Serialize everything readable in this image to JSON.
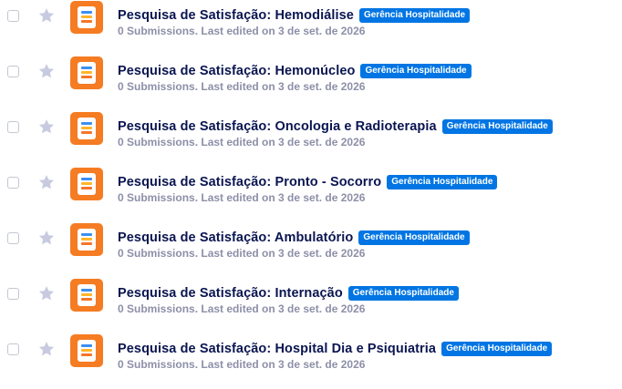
{
  "forms": [
    {
      "title": "Pesquisa de Satisfação: Hemodiálise",
      "badge": "Gerência Hospitalidade",
      "meta": "0 Submissions. Last edited on 3 de set. de 2026"
    },
    {
      "title": "Pesquisa de Satisfação: Hemonúcleo",
      "badge": "Gerência Hospitalidade",
      "meta": "0 Submissions. Last edited on 3 de set. de 2026"
    },
    {
      "title": "Pesquisa de Satisfação: Oncologia e Radioterapia",
      "badge": "Gerência Hospitalidade",
      "meta": "0 Submissions. Last edited on 3 de set. de 2026"
    },
    {
      "title": "Pesquisa de Satisfação: Pronto - Socorro",
      "badge": "Gerência Hospitalidade",
      "meta": "0 Submissions. Last edited on 3 de set. de 2026"
    },
    {
      "title": "Pesquisa de Satisfação: Ambulatório",
      "badge": "Gerência Hospitalidade",
      "meta": "0 Submissions. Last edited on 3 de set. de 2026"
    },
    {
      "title": "Pesquisa de Satisfação: Internação",
      "badge": "Gerência Hospitalidade",
      "meta": "0 Submissions. Last edited on 3 de set. de 2026"
    },
    {
      "title": "Pesquisa de Satisfação: Hospital Dia e Psiquiatria",
      "badge": "Gerência Hospitalidade",
      "meta": "0 Submissions. Last edited on 3 de set. de 2026"
    }
  ],
  "icons": {
    "star": "star-icon",
    "form": "form-icon"
  },
  "colors": {
    "title": "#0a1551",
    "meta": "#8d8fa8",
    "badge_bg": "#0075e3",
    "form_icon_bg": "#f57c22",
    "star": "#c8cbe0"
  }
}
